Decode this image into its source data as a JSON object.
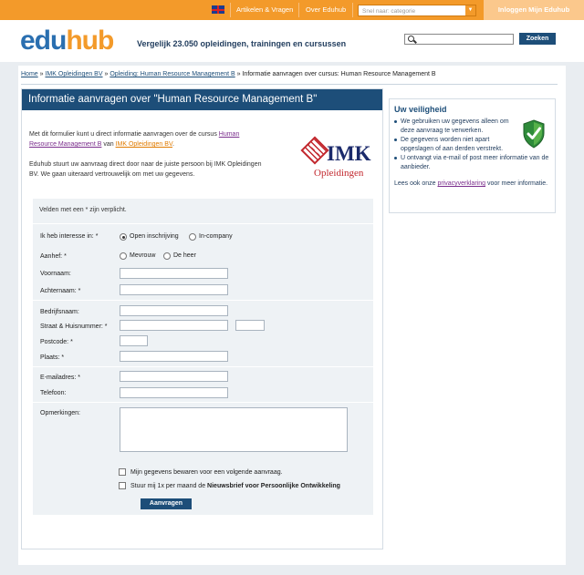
{
  "topbar": {
    "flag_icon": "uk-flag-icon",
    "articles_label": "Artikelen & Vragen",
    "about_label": "Over Eduhub",
    "category_placeholder": "Snel naar: categorie",
    "login_label": "Inloggen Mijn Eduhub",
    "colors": {
      "bar": "#f39a2a",
      "login": "#fbc88c"
    }
  },
  "header": {
    "logo_edu": "edu",
    "logo_hub": "hub",
    "tagline": "Vergelijk 23.050 opleidingen, trainingen en cursussen",
    "search_icon": "search-icon",
    "search_button": "Zoeken"
  },
  "breadcrumb": {
    "home": "Home",
    "sep": " » ",
    "provider": "IMK Opleidingen BV",
    "course": "Opleiding: Human Resource Management B",
    "current": "Informatie aanvragen over cursus: Human Resource Management B"
  },
  "main": {
    "title": "Informatie aanvragen over \"Human Resource Management B\"",
    "intro1_pre": "Met dit formulier kunt u direct informatie aanvragen over de cursus ",
    "intro1_link": "Human Resource Management B",
    "intro1_mid": " van ",
    "intro1_link2": "IMK Opleidingen BV",
    "intro1_end": ".",
    "intro2": "Eduhub stuurt uw aanvraag direct door naar de juiste persoon bij IMK Opleidingen BV. We gaan uiteraard vertrouwelijk om met uw gegevens.",
    "logo_name": "IMK",
    "logo_sub": "Opleidingen"
  },
  "form": {
    "required_note": "Velden met een * zijn verplicht.",
    "interest_label": "Ik heb interesse in: *",
    "interest_options": [
      "Open inschrijving",
      "In-company"
    ],
    "interest_selected": "Open inschrijving",
    "salutation_label": "Aanhef: *",
    "salutation_options": [
      "Mevrouw",
      "De heer"
    ],
    "first_name_label": "Voornaam:",
    "last_name_label": "Achternaam: *",
    "company_label": "Bedrijfsnaam:",
    "street_label": "Straat & Huisnummer: *",
    "postcode_label": "Postcode: *",
    "city_label": "Plaats: *",
    "email_label": "E-mailadres: *",
    "phone_label": "Telefoon:",
    "remarks_label": "Opmerkingen:",
    "save_checkbox_label": "Mijn gegevens bewaren voor een volgende aanvraag.",
    "newsletter_pre": "Stuur mij 1x per maand de ",
    "newsletter_bold": "Nieuwsbrief voor Persoonlijke Ontwikkeling",
    "submit_label": "Aanvragen"
  },
  "sidebar": {
    "title": "Uw veiligheid",
    "items": [
      "We gebruiken uw gegevens alleen om deze aanvraag te verwerken.",
      "De gegevens worden niet apart opgeslagen of aan derden verstrekt.",
      "U ontvangt via e-mail of post meer informatie van de aanbieder."
    ],
    "foot_pre": "Lees ook onze ",
    "foot_link": "privacyverklaring",
    "foot_post": " voor meer informatie.",
    "icon": "security-shield-check-icon"
  }
}
